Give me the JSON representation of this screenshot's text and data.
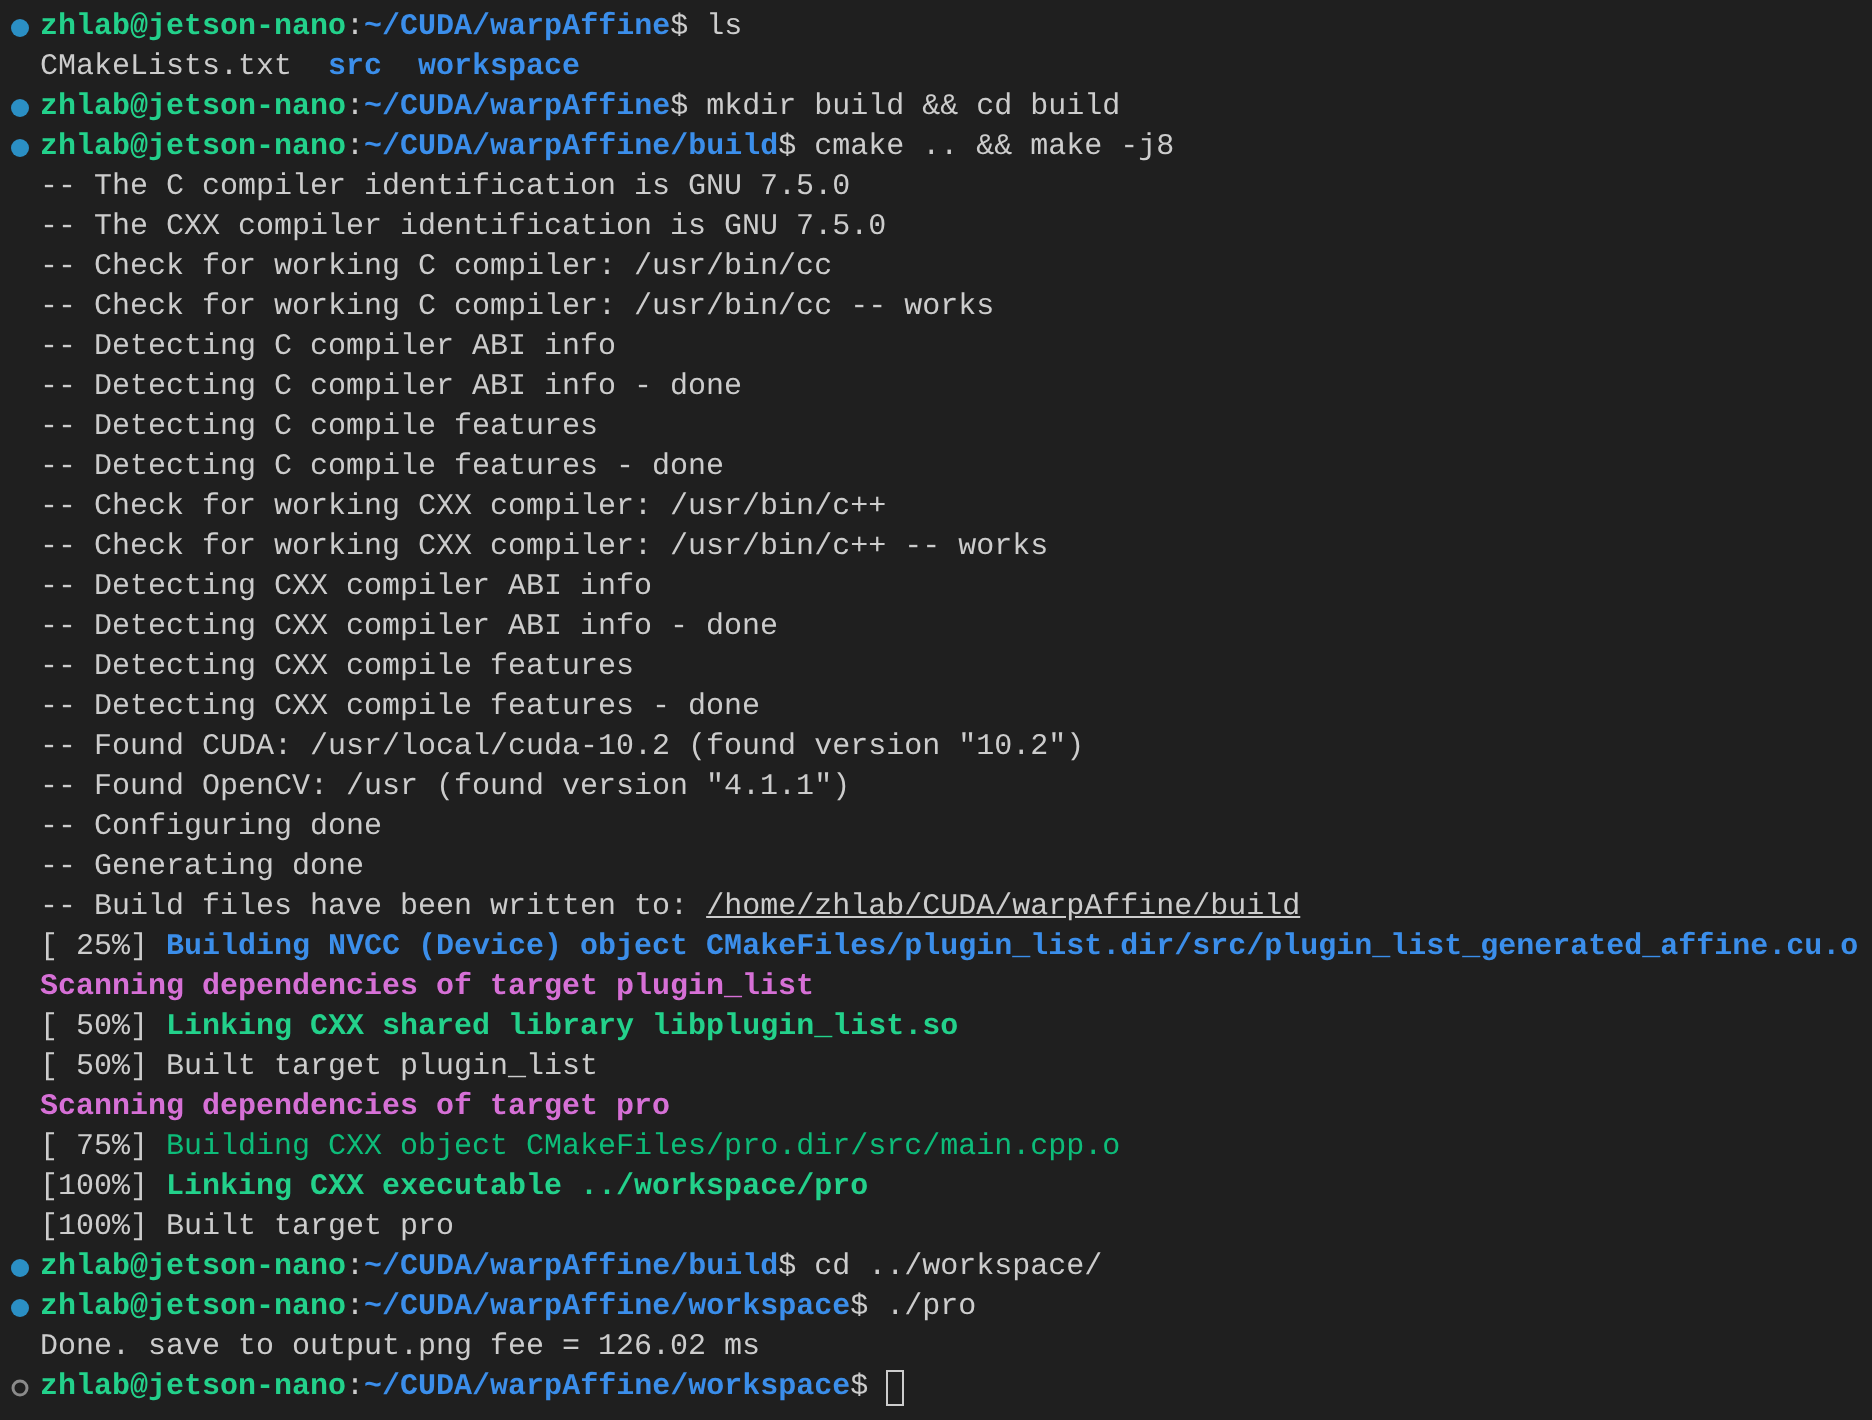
{
  "terminal": {
    "lines": [
      {
        "kind": "prompt",
        "finished": true,
        "cursor": false,
        "segments": [
          {
            "kind": "user",
            "text": "zhlab@jetson-nano"
          },
          {
            "kind": "plain",
            "text": ":"
          },
          {
            "kind": "path",
            "text": "~/CUDA/warpAffine"
          },
          {
            "kind": "plain",
            "text": "$ ls"
          }
        ]
      },
      {
        "kind": "output",
        "cursor": false,
        "segments": [
          {
            "kind": "plain",
            "text": "CMakeLists.txt  "
          },
          {
            "kind": "path",
            "text": "src  "
          },
          {
            "kind": "path",
            "text": "workspace"
          }
        ]
      },
      {
        "kind": "prompt",
        "finished": true,
        "cursor": false,
        "segments": [
          {
            "kind": "user",
            "text": "zhlab@jetson-nano"
          },
          {
            "kind": "plain",
            "text": ":"
          },
          {
            "kind": "path",
            "text": "~/CUDA/warpAffine"
          },
          {
            "kind": "plain",
            "text": "$ mkdir build && cd build"
          }
        ]
      },
      {
        "kind": "prompt",
        "finished": true,
        "cursor": false,
        "segments": [
          {
            "kind": "user",
            "text": "zhlab@jetson-nano"
          },
          {
            "kind": "plain",
            "text": ":"
          },
          {
            "kind": "path",
            "text": "~/CUDA/warpAffine/build"
          },
          {
            "kind": "plain",
            "text": "$ cmake .. && make -j8"
          }
        ]
      },
      {
        "kind": "output",
        "cursor": false,
        "segments": [
          {
            "kind": "plain",
            "text": "-- The C compiler identification is GNU 7.5.0"
          }
        ]
      },
      {
        "kind": "output",
        "cursor": false,
        "segments": [
          {
            "kind": "plain",
            "text": "-- The CXX compiler identification is GNU 7.5.0"
          }
        ]
      },
      {
        "kind": "output",
        "cursor": false,
        "segments": [
          {
            "kind": "plain",
            "text": "-- Check for working C compiler: /usr/bin/cc"
          }
        ]
      },
      {
        "kind": "output",
        "cursor": false,
        "segments": [
          {
            "kind": "plain",
            "text": "-- Check for working C compiler: /usr/bin/cc -- works"
          }
        ]
      },
      {
        "kind": "output",
        "cursor": false,
        "segments": [
          {
            "kind": "plain",
            "text": "-- Detecting C compiler ABI info"
          }
        ]
      },
      {
        "kind": "output",
        "cursor": false,
        "segments": [
          {
            "kind": "plain",
            "text": "-- Detecting C compiler ABI info - done"
          }
        ]
      },
      {
        "kind": "output",
        "cursor": false,
        "segments": [
          {
            "kind": "plain",
            "text": "-- Detecting C compile features"
          }
        ]
      },
      {
        "kind": "output",
        "cursor": false,
        "segments": [
          {
            "kind": "plain",
            "text": "-- Detecting C compile features - done"
          }
        ]
      },
      {
        "kind": "output",
        "cursor": false,
        "segments": [
          {
            "kind": "plain",
            "text": "-- Check for working CXX compiler: /usr/bin/c++"
          }
        ]
      },
      {
        "kind": "output",
        "cursor": false,
        "segments": [
          {
            "kind": "plain",
            "text": "-- Check for working CXX compiler: /usr/bin/c++ -- works"
          }
        ]
      },
      {
        "kind": "output",
        "cursor": false,
        "segments": [
          {
            "kind": "plain",
            "text": "-- Detecting CXX compiler ABI info"
          }
        ]
      },
      {
        "kind": "output",
        "cursor": false,
        "segments": [
          {
            "kind": "plain",
            "text": "-- Detecting CXX compiler ABI info - done"
          }
        ]
      },
      {
        "kind": "output",
        "cursor": false,
        "segments": [
          {
            "kind": "plain",
            "text": "-- Detecting CXX compile features"
          }
        ]
      },
      {
        "kind": "output",
        "cursor": false,
        "segments": [
          {
            "kind": "plain",
            "text": "-- Detecting CXX compile features - done"
          }
        ]
      },
      {
        "kind": "output",
        "cursor": false,
        "segments": [
          {
            "kind": "plain",
            "text": "-- Found CUDA: /usr/local/cuda-10.2 (found version \"10.2\")"
          }
        ]
      },
      {
        "kind": "output",
        "cursor": false,
        "segments": [
          {
            "kind": "plain",
            "text": "-- Found OpenCV: /usr (found version \"4.1.1\")"
          }
        ]
      },
      {
        "kind": "output",
        "cursor": false,
        "segments": [
          {
            "kind": "plain",
            "text": "-- Configuring done"
          }
        ]
      },
      {
        "kind": "output",
        "cursor": false,
        "segments": [
          {
            "kind": "plain",
            "text": "-- Generating done"
          }
        ]
      },
      {
        "kind": "output",
        "cursor": false,
        "segments": [
          {
            "kind": "plain",
            "text": "-- Build files have been written to: "
          },
          {
            "kind": "link",
            "text": "/home/zhlab/CUDA/warpAffine/build"
          }
        ]
      },
      {
        "kind": "output",
        "cursor": false,
        "segments": [
          {
            "kind": "plain",
            "text": "[ 25%] "
          },
          {
            "kind": "path",
            "text": "Building NVCC (Device) object CMakeFiles/plugin_list.dir/src/plugin_list_generated_affine.cu.o"
          }
        ]
      },
      {
        "kind": "output",
        "cursor": false,
        "segments": [
          {
            "kind": "magenta",
            "text": "Scanning dependencies of target plugin_list"
          }
        ]
      },
      {
        "kind": "output",
        "cursor": false,
        "segments": [
          {
            "kind": "plain",
            "text": "[ 50%] "
          },
          {
            "kind": "user",
            "text": "Linking CXX shared library libplugin_list.so"
          }
        ]
      },
      {
        "kind": "output",
        "cursor": false,
        "segments": [
          {
            "kind": "plain",
            "text": "[ 50%] Built target plugin_list"
          }
        ]
      },
      {
        "kind": "output",
        "cursor": false,
        "segments": [
          {
            "kind": "magenta",
            "text": "Scanning dependencies of target pro"
          }
        ]
      },
      {
        "kind": "output",
        "cursor": false,
        "segments": [
          {
            "kind": "plain",
            "text": "[ 75%] "
          },
          {
            "kind": "green",
            "text": "Building CXX object CMakeFiles/pro.dir/src/main.cpp.o"
          }
        ]
      },
      {
        "kind": "output",
        "cursor": false,
        "segments": [
          {
            "kind": "plain",
            "text": "[100%] "
          },
          {
            "kind": "user",
            "text": "Linking CXX executable ../workspace/pro"
          }
        ]
      },
      {
        "kind": "output",
        "cursor": false,
        "segments": [
          {
            "kind": "plain",
            "text": "[100%] Built target pro"
          }
        ]
      },
      {
        "kind": "prompt",
        "finished": true,
        "cursor": false,
        "segments": [
          {
            "kind": "user",
            "text": "zhlab@jetson-nano"
          },
          {
            "kind": "plain",
            "text": ":"
          },
          {
            "kind": "path",
            "text": "~/CUDA/warpAffine/build"
          },
          {
            "kind": "plain",
            "text": "$ cd ../workspace/"
          }
        ]
      },
      {
        "kind": "prompt",
        "finished": true,
        "cursor": false,
        "segments": [
          {
            "kind": "user",
            "text": "zhlab@jetson-nano"
          },
          {
            "kind": "plain",
            "text": ":"
          },
          {
            "kind": "path",
            "text": "~/CUDA/warpAffine/workspace"
          },
          {
            "kind": "plain",
            "text": "$ ./pro"
          }
        ]
      },
      {
        "kind": "output",
        "cursor": false,
        "segments": [
          {
            "kind": "plain",
            "text": "Done. save to output.png fee = 126.02 ms"
          }
        ]
      },
      {
        "kind": "prompt",
        "finished": false,
        "cursor": true,
        "segments": [
          {
            "kind": "user",
            "text": "zhlab@jetson-nano"
          },
          {
            "kind": "plain",
            "text": ":"
          },
          {
            "kind": "path",
            "text": "~/CUDA/warpAffine/workspace"
          },
          {
            "kind": "plain",
            "text": "$"
          }
        ]
      }
    ]
  }
}
